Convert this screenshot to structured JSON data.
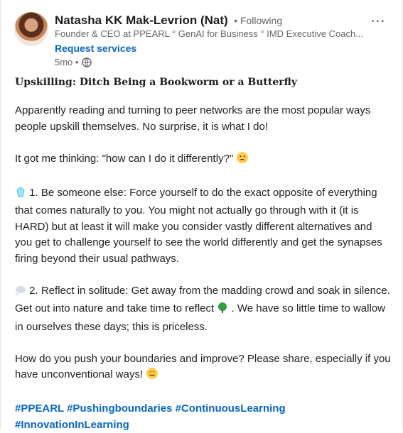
{
  "post": {
    "author": {
      "name": "Natasha KK Mak-Levrion (Nat)",
      "following": "• Following",
      "headline": "Founder & CEO at PPEARL ° GenAI for Business ° IMD Executive Coach...",
      "cta": "Request services",
      "timestamp": "5mo •"
    },
    "menu_icon": "more-horizontal-icon",
    "title": "Upskilling: Ditch Being a Bookworm or a Butterfly",
    "paragraphs": {
      "p1": "Apparently reading and turning to peer networks are the most popular ways people upskill themselves. No surprise, it is what I do!",
      "p2": "It got me thinking: \"how can I do it differently?\"",
      "p3": "1.  Be someone else: Force yourself to do the exact opposite of everything that comes naturally to you. You might not actually go through with it (it is HARD) but at least it will make you consider vastly different alternatives and you get to challenge yourself to see the world differently and get the synapses firing beyond their usual pathways.",
      "p4_a": "2.  Reflect in solitude: Get away from the madding crowd and soak in silence. Get out into nature and take time to reflect",
      "p4_b": ". We have so little time to wallow in ourselves these days; this is priceless.",
      "p5": "How do you push your boundaries and improve? Please share, especially if you have unconventional ways!"
    },
    "hashtags": [
      "#PPEARL",
      "#Pushingboundaries",
      "#ContinuousLearning",
      "#InnovationInLearning"
    ]
  }
}
